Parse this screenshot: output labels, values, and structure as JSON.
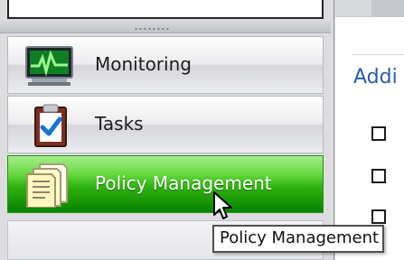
{
  "navigation": {
    "items": [
      {
        "label": "Monitoring",
        "icon": "monitoring-icon",
        "selected": false
      },
      {
        "label": "Tasks",
        "icon": "tasks-icon",
        "selected": false
      },
      {
        "label": "Policy Management",
        "icon": "policy-management-icon",
        "selected": true
      }
    ]
  },
  "details": {
    "link_text": "Addi"
  },
  "tooltip": {
    "text": "Policy Management"
  },
  "colors": {
    "selected_green": "#2fb20f",
    "link_blue": "#2b5ca8",
    "tooltip_border": "#505050"
  }
}
